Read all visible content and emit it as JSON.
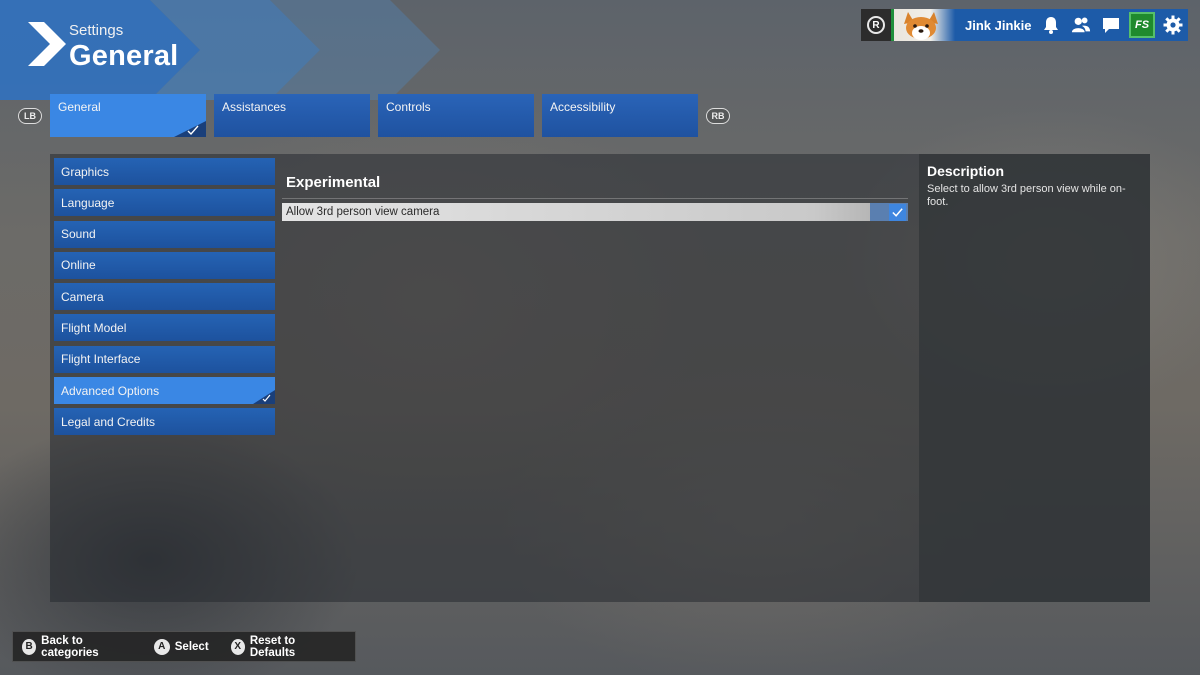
{
  "header": {
    "breadcrumb": "Settings",
    "title": "General"
  },
  "userbar": {
    "rank_label": "R",
    "username": "Jink Jinkie",
    "fs_label": "FS",
    "icons": [
      "notifications-icon",
      "friends-icon",
      "chat-icon",
      "marketplace-icon",
      "gear-icon"
    ]
  },
  "tabs": {
    "left_bumper": "LB",
    "right_bumper": "RB",
    "items": [
      {
        "label": "General",
        "active": true
      },
      {
        "label": "Assistances",
        "active": false
      },
      {
        "label": "Controls",
        "active": false
      },
      {
        "label": "Accessibility",
        "active": false
      }
    ]
  },
  "sidebar": {
    "items": [
      {
        "label": "Graphics"
      },
      {
        "label": "Language"
      },
      {
        "label": "Sound"
      },
      {
        "label": "Online"
      },
      {
        "label": "Camera"
      },
      {
        "label": "Flight Model"
      },
      {
        "label": "Flight Interface"
      },
      {
        "label": "Advanced Options",
        "active": true
      },
      {
        "label": "Legal and Credits"
      }
    ]
  },
  "content": {
    "section_title": "Experimental",
    "settings": [
      {
        "label": "Allow 3rd person view camera",
        "checked": true
      }
    ]
  },
  "description": {
    "title": "Description",
    "text": "Select to allow 3rd person view while on-foot."
  },
  "footer": {
    "hints": [
      {
        "button": "B",
        "label": "Back to categories"
      },
      {
        "button": "A",
        "label": "Select"
      },
      {
        "button": "X",
        "label": "Reset to Defaults"
      }
    ]
  },
  "colors": {
    "tab_blue": "#1f52a0",
    "active_blue": "#3a87e4",
    "userbar_blue": "#1d5ba8"
  }
}
